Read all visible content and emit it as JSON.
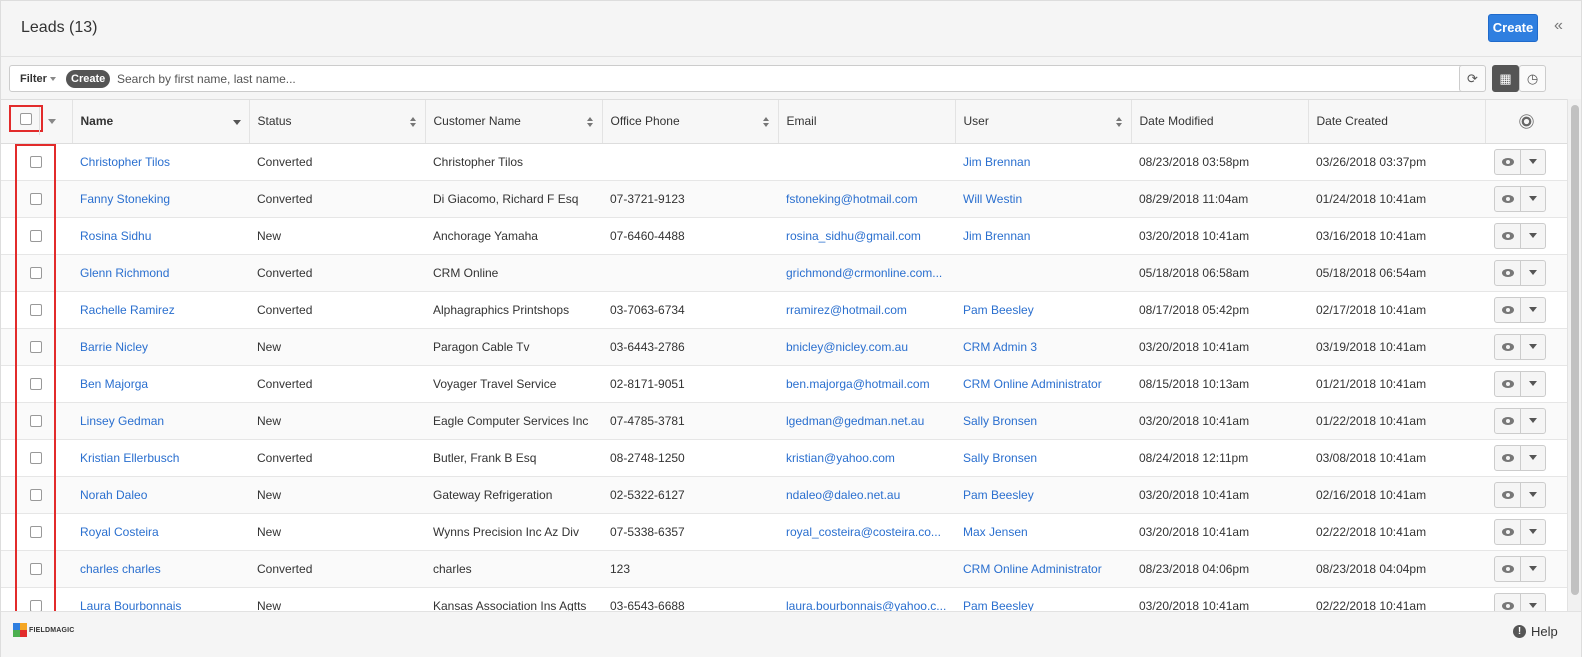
{
  "header": {
    "title": "Leads (13)",
    "create_label": "Create",
    "collapse_icon": "double-chevron-left-icon"
  },
  "filter_bar": {
    "filter_label": "Filter",
    "create_label": "Create",
    "search_placeholder": "Search by first name, last name...",
    "refresh_icon": "refresh-icon",
    "grid_view_icon": "grid-icon",
    "history_icon": "clock-icon"
  },
  "columns": {
    "name": "Name",
    "status": "Status",
    "customer_name": "Customer Name",
    "office_phone": "Office Phone",
    "email": "Email",
    "user": "User",
    "date_modified": "Date Modified",
    "date_created": "Date Created"
  },
  "rows": [
    {
      "name": "Christopher Tilos",
      "status": "Converted",
      "customer": "Christopher Tilos",
      "phone": "",
      "email": "",
      "user": "Jim Brennan",
      "modified": "08/23/2018 03:58pm",
      "created": "03/26/2018 03:37pm"
    },
    {
      "name": "Fanny Stoneking",
      "status": "Converted",
      "customer": "Di Giacomo, Richard F Esq",
      "phone": "07-3721-9123",
      "email": "fstoneking@hotmail.com",
      "user": "Will Westin",
      "modified": "08/29/2018 11:04am",
      "created": "01/24/2018 10:41am"
    },
    {
      "name": "Rosina Sidhu",
      "status": "New",
      "customer": "Anchorage Yamaha",
      "phone": "07-6460-4488",
      "email": "rosina_sidhu@gmail.com",
      "user": "Jim Brennan",
      "modified": "03/20/2018 10:41am",
      "created": "03/16/2018 10:41am"
    },
    {
      "name": "Glenn Richmond",
      "status": "Converted",
      "customer": "CRM Online",
      "phone": "",
      "email": "grichmond@crmonline.com...",
      "user": "",
      "modified": "05/18/2018 06:58am",
      "created": "05/18/2018 06:54am"
    },
    {
      "name": "Rachelle Ramirez",
      "status": "Converted",
      "customer": "Alphagraphics Printshops",
      "phone": "03-7063-6734",
      "email": "rramirez@hotmail.com",
      "user": "Pam Beesley",
      "modified": "08/17/2018 05:42pm",
      "created": "02/17/2018 10:41am"
    },
    {
      "name": "Barrie Nicley",
      "status": "New",
      "customer": "Paragon Cable Tv",
      "phone": "03-6443-2786",
      "email": "bnicley@nicley.com.au",
      "user": "CRM Admin 3",
      "modified": "03/20/2018 10:41am",
      "created": "03/19/2018 10:41am"
    },
    {
      "name": "Ben Majorga",
      "status": "Converted",
      "customer": "Voyager Travel Service",
      "phone": "02-8171-9051",
      "email": "ben.majorga@hotmail.com",
      "user": "CRM Online Administrator",
      "modified": "08/15/2018 10:13am",
      "created": "01/21/2018 10:41am"
    },
    {
      "name": "Linsey Gedman",
      "status": "New",
      "customer": "Eagle Computer Services Inc",
      "phone": "07-4785-3781",
      "email": "lgedman@gedman.net.au",
      "user": "Sally Bronsen",
      "modified": "03/20/2018 10:41am",
      "created": "01/22/2018 10:41am"
    },
    {
      "name": "Kristian Ellerbusch",
      "status": "Converted",
      "customer": "Butler, Frank B Esq",
      "phone": "08-2748-1250",
      "email": "kristian@yahoo.com",
      "user": "Sally Bronsen",
      "modified": "08/24/2018 12:11pm",
      "created": "03/08/2018 10:41am"
    },
    {
      "name": "Norah Daleo",
      "status": "New",
      "customer": "Gateway Refrigeration",
      "phone": "02-5322-6127",
      "email": "ndaleo@daleo.net.au",
      "user": "Pam Beesley",
      "modified": "03/20/2018 10:41am",
      "created": "02/16/2018 10:41am"
    },
    {
      "name": "Royal Costeira",
      "status": "New",
      "customer": "Wynns Precision Inc Az Div",
      "phone": "07-5338-6357",
      "email": "royal_costeira@costeira.co...",
      "user": "Max Jensen",
      "modified": "03/20/2018 10:41am",
      "created": "02/22/2018 10:41am"
    },
    {
      "name": "charles charles",
      "status": "Converted",
      "customer": "charles",
      "phone": "123",
      "email": "",
      "user": "CRM Online Administrator",
      "modified": "08/23/2018 04:06pm",
      "created": "08/23/2018 04:04pm"
    },
    {
      "name": "Laura Bourbonnais",
      "status": "New",
      "customer": "Kansas Association Ins Agtts",
      "phone": "03-6543-6688",
      "email": "laura.bourbonnais@yahoo.c...",
      "user": "Pam Beesley",
      "modified": "03/20/2018 10:41am",
      "created": "02/22/2018 10:41am"
    }
  ],
  "footer": {
    "logo_text": "FIELDMAGIC",
    "help_label": "Help"
  },
  "colors": {
    "accent": "#2f7fe0",
    "link": "#2a6fcf",
    "highlight": "#e22b2b"
  }
}
